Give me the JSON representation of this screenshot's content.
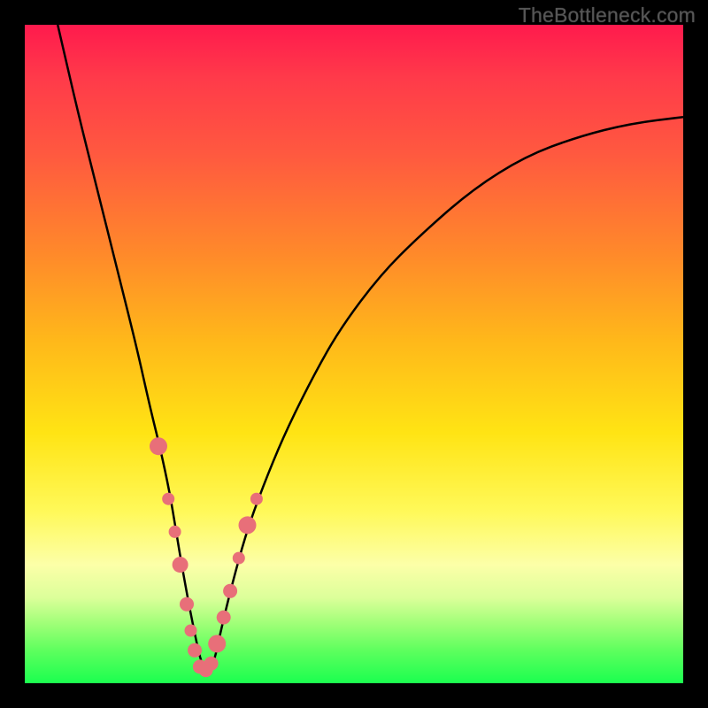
{
  "watermark": "TheBottleneck.com",
  "chart_data": {
    "type": "line",
    "title": "",
    "xlabel": "",
    "ylabel": "",
    "xlim": [
      0,
      100
    ],
    "ylim": [
      0,
      100
    ],
    "series": [
      {
        "name": "curve",
        "x": [
          5,
          8,
          11,
          14,
          17,
          19,
          20.5,
          22,
          23,
          24,
          25.5,
          27,
          28.5,
          30,
          32,
          34,
          37,
          40,
          44,
          48,
          54,
          60,
          68,
          76,
          84,
          92,
          100
        ],
        "y": [
          100,
          87,
          75,
          63,
          51,
          42,
          36,
          29,
          23,
          17,
          9,
          2,
          2,
          9,
          17,
          24,
          32,
          39,
          47,
          54,
          62,
          68,
          75,
          80,
          83,
          85,
          86
        ]
      }
    ],
    "markers": {
      "name": "highlight-dots",
      "color": "#e86f79",
      "points": [
        {
          "x": 20.3,
          "y": 36,
          "r": 10,
          "shape": "pill",
          "len": 20
        },
        {
          "x": 21.8,
          "y": 28,
          "r": 7
        },
        {
          "x": 22.8,
          "y": 23,
          "r": 7
        },
        {
          "x": 23.6,
          "y": 18,
          "r": 9
        },
        {
          "x": 24.6,
          "y": 12,
          "r": 8
        },
        {
          "x": 25.2,
          "y": 8,
          "r": 7
        },
        {
          "x": 25.8,
          "y": 5,
          "r": 8
        },
        {
          "x": 26.6,
          "y": 2.5,
          "r": 8
        },
        {
          "x": 27.5,
          "y": 2,
          "r": 8
        },
        {
          "x": 28.3,
          "y": 3,
          "r": 8
        },
        {
          "x": 29.2,
          "y": 6,
          "r": 10
        },
        {
          "x": 30.2,
          "y": 10,
          "r": 8
        },
        {
          "x": 31.2,
          "y": 14,
          "r": 8
        },
        {
          "x": 32.5,
          "y": 19,
          "r": 7
        },
        {
          "x": 33.8,
          "y": 24,
          "r": 10,
          "shape": "pill",
          "len": 20
        },
        {
          "x": 35.2,
          "y": 28,
          "r": 7
        }
      ]
    },
    "gradient_stops": [
      {
        "pos": 0,
        "color": "#ff1a4d"
      },
      {
        "pos": 20,
        "color": "#ff5a3f"
      },
      {
        "pos": 48,
        "color": "#ffb81a"
      },
      {
        "pos": 74,
        "color": "#fff95a"
      },
      {
        "pos": 100,
        "color": "#1bff4f"
      }
    ]
  }
}
